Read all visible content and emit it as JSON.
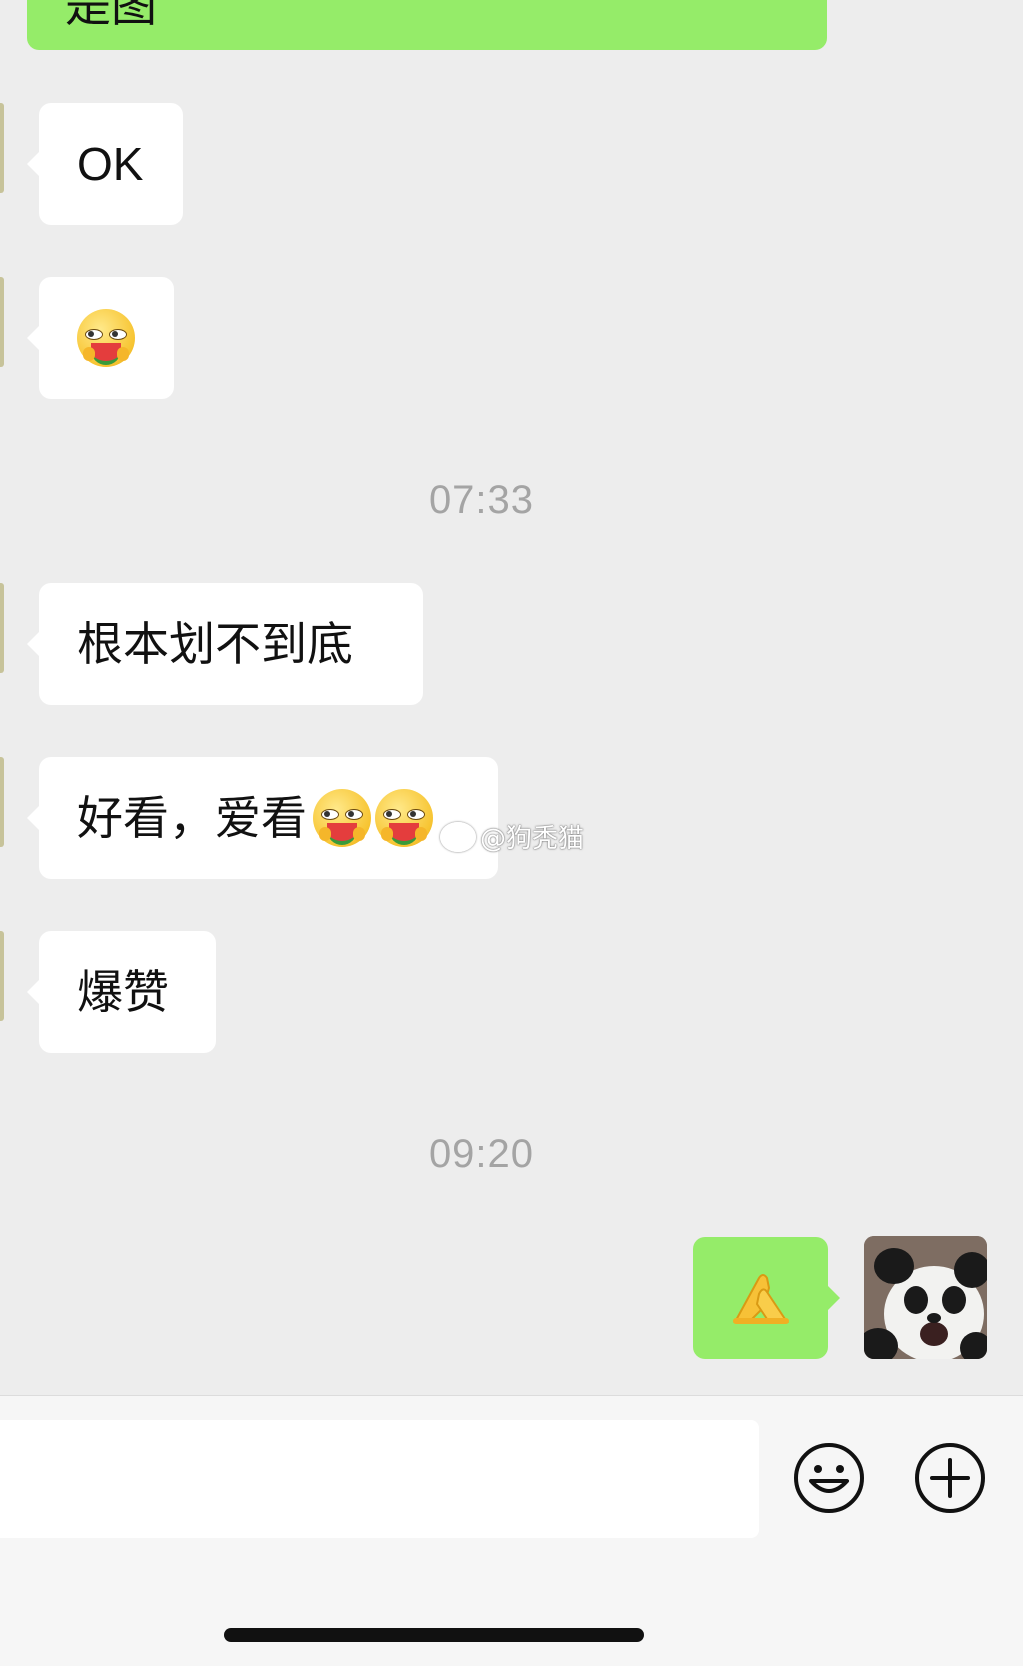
{
  "messages": [
    {
      "id": "top",
      "direction": "outgoing",
      "text": "是图"
    },
    {
      "id": "ok",
      "direction": "incoming",
      "text": "OK"
    },
    {
      "id": "emoji1",
      "direction": "incoming",
      "emoji": "watermelon-eating-face-icon"
    },
    {
      "id": "t1",
      "timestamp": "07:33"
    },
    {
      "id": "m3",
      "direction": "incoming",
      "text": "根本划不到底"
    },
    {
      "id": "m4",
      "direction": "incoming",
      "text": "好看，爱看"
    },
    {
      "id": "m5",
      "direction": "incoming",
      "text": "爆赞"
    },
    {
      "id": "t2",
      "timestamp": "09:20"
    },
    {
      "id": "m6",
      "direction": "outgoing",
      "emoji": "pressed-hands-icon"
    }
  ],
  "watermark": {
    "text": "@狗秃猫"
  },
  "input_bar": {
    "field_value": "",
    "emoji_button": "smiley-icon",
    "more_button": "plus-icon"
  },
  "colors": {
    "background": "#ededed",
    "incoming_bubble": "#ffffff",
    "outgoing_bubble": "#95ec69",
    "timestamp": "#a4a4a4"
  }
}
